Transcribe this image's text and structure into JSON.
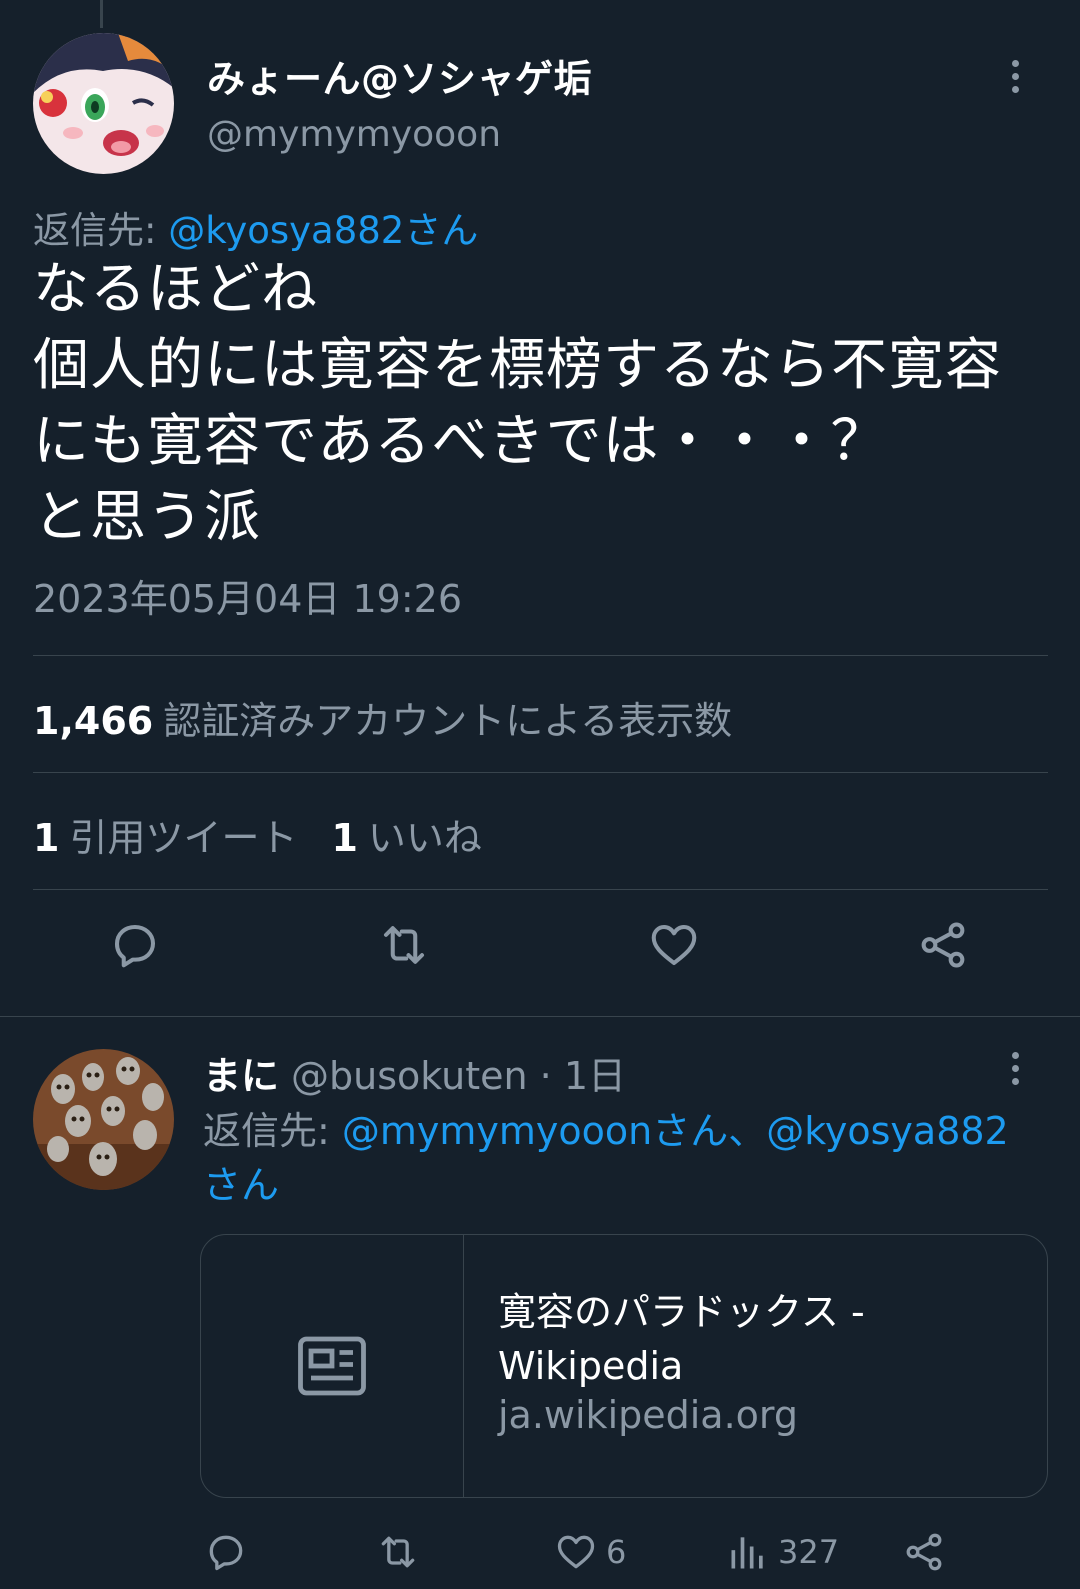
{
  "tweet": {
    "author_name": "みょーん@ソシャゲ垢",
    "author_handle": "@mymymyooon",
    "reply_to_label": "返信先: ",
    "reply_to_mention": "@kyosya882さん",
    "text": "なるほどね\n個人的には寛容を標榜するなら不寛容にも寛容であるべきでは・・・？\nと思う派",
    "timestamp": "2023年05月04日 19:26",
    "views_count": "1,466",
    "views_label": "認証済みアカウントによる表示数",
    "quote_count": "1",
    "quote_label": "引用ツイート",
    "like_count": "1",
    "like_label": "いいね"
  },
  "reply": {
    "author_name": "まに",
    "author_handle": "@busokuten",
    "separator": " · ",
    "time": "1日",
    "reply_to_label": "返信先: ",
    "reply_to_mentions": "@mymymyooonさん、@kyosya882さん",
    "card": {
      "title": "寛容のパラドックス - Wikipedia",
      "domain": "ja.wikipedia.org"
    },
    "like_count": "6",
    "view_count": "327"
  },
  "icons": {
    "reply": "reply-icon",
    "retweet": "retweet-icon",
    "like": "heart-icon",
    "share": "share-icon",
    "views": "views-icon",
    "more": "more-icon",
    "article": "article-icon"
  },
  "colors": {
    "background": "#15202b",
    "text_primary": "#ffffff",
    "text_secondary": "#8b98a5",
    "accent": "#1d9bf0",
    "divider": "#38444d"
  }
}
